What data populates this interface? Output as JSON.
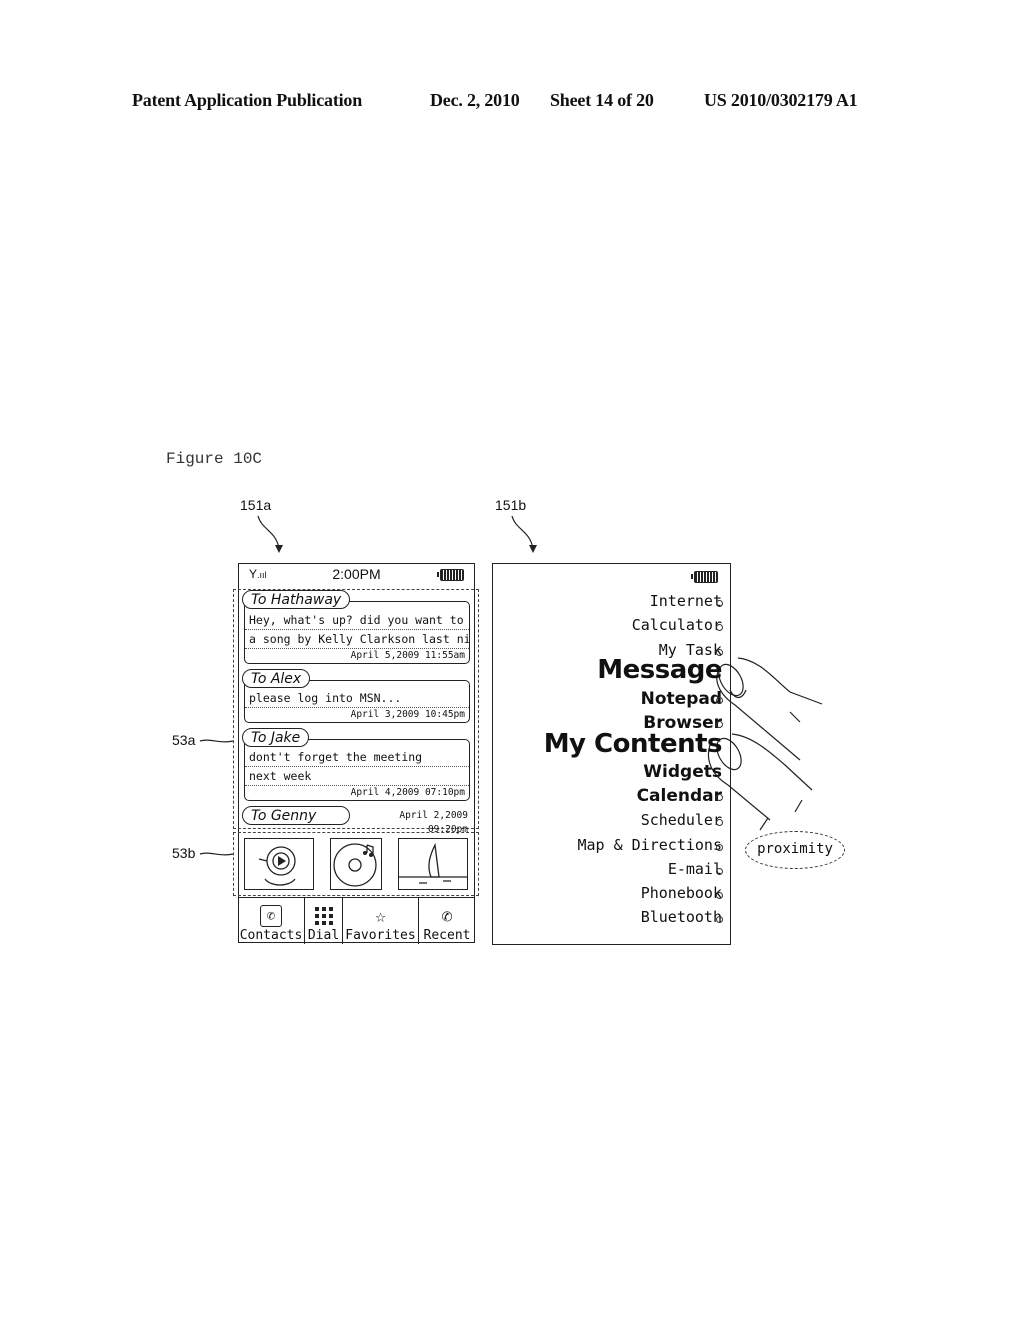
{
  "header": {
    "publication": "Patent Application Publication",
    "date": "Dec. 2, 2010",
    "sheet": "Sheet 14 of 20",
    "number": "US 2010/0302179 A1"
  },
  "figure_label": "Figure 10C",
  "refs": {
    "left_screen": "151a",
    "right_screen": "151b",
    "messages_region": "53a",
    "media_region": "53b"
  },
  "left_screen": {
    "status": {
      "time": "2:00PM",
      "signal_icon": "signal-icon",
      "battery_icon": "battery-icon"
    },
    "messages": [
      {
        "to": "To Hathaway",
        "lines": [
          "Hey, what's up? did you want to get",
          "a song by Kelly Clarkson last night?"
        ],
        "date": "April 5,2009 11:55am"
      },
      {
        "to": "To Alex",
        "lines": [
          "please log into MSN..."
        ],
        "date": "April 3,2009 10:45pm"
      },
      {
        "to": "To Jake",
        "lines": [
          "dont't forget the meeting",
          "next week"
        ],
        "date": "April 4,2009 07:10pm"
      },
      {
        "to": "To Genny",
        "lines": [],
        "date": "April 2,2009 09:20pm"
      }
    ],
    "media_thumbnails": [
      {
        "name": "lion-video-thumbnail",
        "icon": "play-icon"
      },
      {
        "name": "music-album-thumbnail",
        "icon": "music-note-icon"
      },
      {
        "name": "windsurf-photo-thumbnail",
        "icon": "image-icon"
      }
    ],
    "toolbar": [
      {
        "label": "Contacts",
        "icon": "phone-icon",
        "glyph": "✆"
      },
      {
        "label": "Dial",
        "icon": "keypad-icon",
        "glyph": "▦"
      },
      {
        "label": "Favorites",
        "icon": "star-icon",
        "glyph": "☆"
      },
      {
        "label": "Recent",
        "icon": "recent-calls-icon",
        "glyph": "✆"
      }
    ]
  },
  "right_screen": {
    "battery_icon": "battery-icon",
    "menu": [
      {
        "label": "Internet",
        "size": "small",
        "dot": true
      },
      {
        "label": "Calculator",
        "size": "small",
        "dot": true
      },
      {
        "label": "My Task",
        "size": "small",
        "dot": true
      },
      {
        "label": "Message",
        "size": "big",
        "dot": false
      },
      {
        "label": "Notepad",
        "size": "medium",
        "dot": true
      },
      {
        "label": "Browser",
        "size": "medium",
        "dot": true
      },
      {
        "label": "My Contents",
        "size": "big",
        "dot": false
      },
      {
        "label": "Widgets",
        "size": "medium",
        "dot": false
      },
      {
        "label": "Calendar",
        "size": "medium",
        "dot": true
      },
      {
        "label": "Scheduler",
        "size": "small",
        "dot": true
      },
      {
        "label": "Map & Directions",
        "size": "small",
        "dot": true
      },
      {
        "label": "E-mail",
        "size": "small",
        "dot": true
      },
      {
        "label": "Phonebook",
        "size": "small",
        "dot": true
      },
      {
        "label": "Bluetooth",
        "size": "small",
        "dot": true
      }
    ],
    "proximity_label": "proximity"
  }
}
